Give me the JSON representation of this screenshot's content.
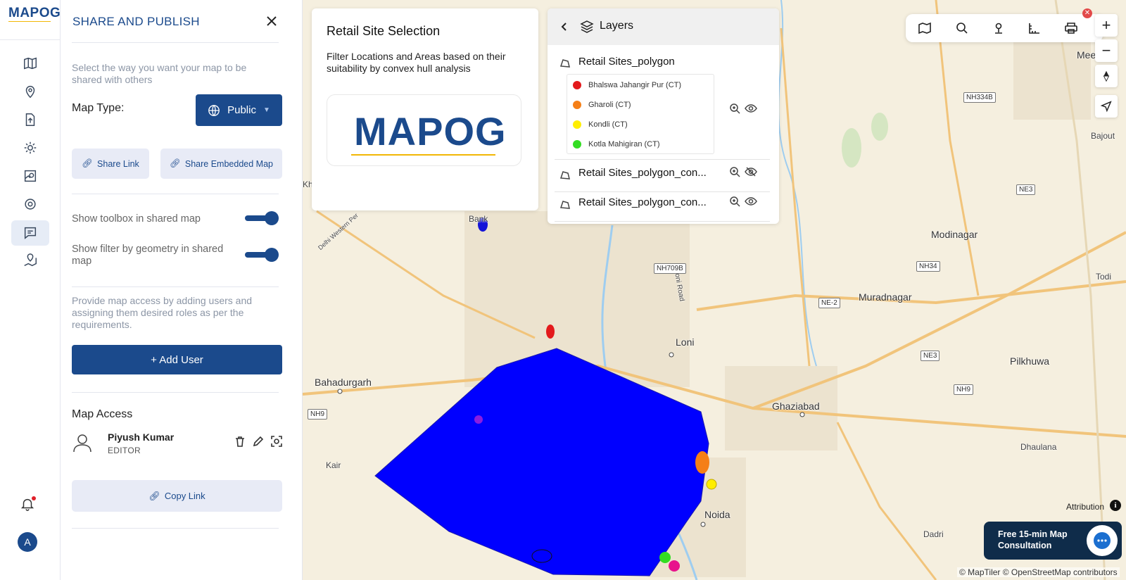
{
  "app": {
    "logo": "MAPOG"
  },
  "panel": {
    "title": "SHARE AND PUBLISH",
    "intro": "Select the way you want your map to be shared with others",
    "map_type_label": "Map Type:",
    "map_type_value": "Public",
    "share_link_label": "Share Link",
    "share_embedded_label": "Share Embedded Map",
    "toggle_toolbox_label": "Show toolbox in shared map",
    "toggle_filter_label": "Show filter by geometry in shared map",
    "access_intro": "Provide map access by adding users and assigning them desired roles as per the requirements.",
    "add_user_label": "+ Add User",
    "map_access_title": "Map Access",
    "user": {
      "name": "Piyush Kumar",
      "role": "EDITOR"
    },
    "copy_link_label": "Copy Link"
  },
  "info_card": {
    "title": "Retail Site Selection",
    "description": "Filter Locations and Areas based on their suitability by convex hull analysis",
    "logo_text": "MAPOG"
  },
  "layers": {
    "title": "Layers",
    "items": [
      {
        "name": "Retail Sites_polygon",
        "visible": true
      },
      {
        "name": "Retail Sites_polygon_con...",
        "visible": false
      },
      {
        "name": "Retail Sites_polygon_con...",
        "visible": true
      }
    ],
    "legend": [
      {
        "label": "Bhalswa Jahangir Pur (CT)",
        "color": "#e31a1c"
      },
      {
        "label": "Gharoli (CT)",
        "color": "#f57f17"
      },
      {
        "label": "Kondli (CT)",
        "color": "#ffee00"
      },
      {
        "label": "Kotla Mahigiran (CT)",
        "color": "#33dd22"
      }
    ]
  },
  "map": {
    "places": {
      "meerut": "Meerut",
      "bajout": "Bajout",
      "modinagar": "Modinagar",
      "todi": "Todi",
      "muradnagar": "Muradnagar",
      "loni": "Loni",
      "bahadurgarh": "Bahadurgarh",
      "ghaziabad": "Ghaziabad",
      "pilkhuwa": "Pilkhuwa",
      "dhaulana": "Dhaulana",
      "noida": "Noida",
      "dadri": "Dadri",
      "kair": "Kair",
      "bank": "Bank",
      "kh": "Kh",
      "loni_road": "Loni Road",
      "delhi_western": "Delhi Western Per"
    },
    "highways": {
      "nh334b": "NH334B",
      "ne3a": "NE3",
      "nh709b": "NH709B",
      "nh34": "NH34",
      "ne2": "NE-2",
      "ne3b": "NE3",
      "nh9a": "NH9",
      "nh9b": "NH9"
    },
    "attribution": "Attribution",
    "copyright": "© MapTiler © OpenStreetMap contributors",
    "consult_text": "Free 15-min Map Consultation",
    "hull_color": "#0000ff"
  }
}
